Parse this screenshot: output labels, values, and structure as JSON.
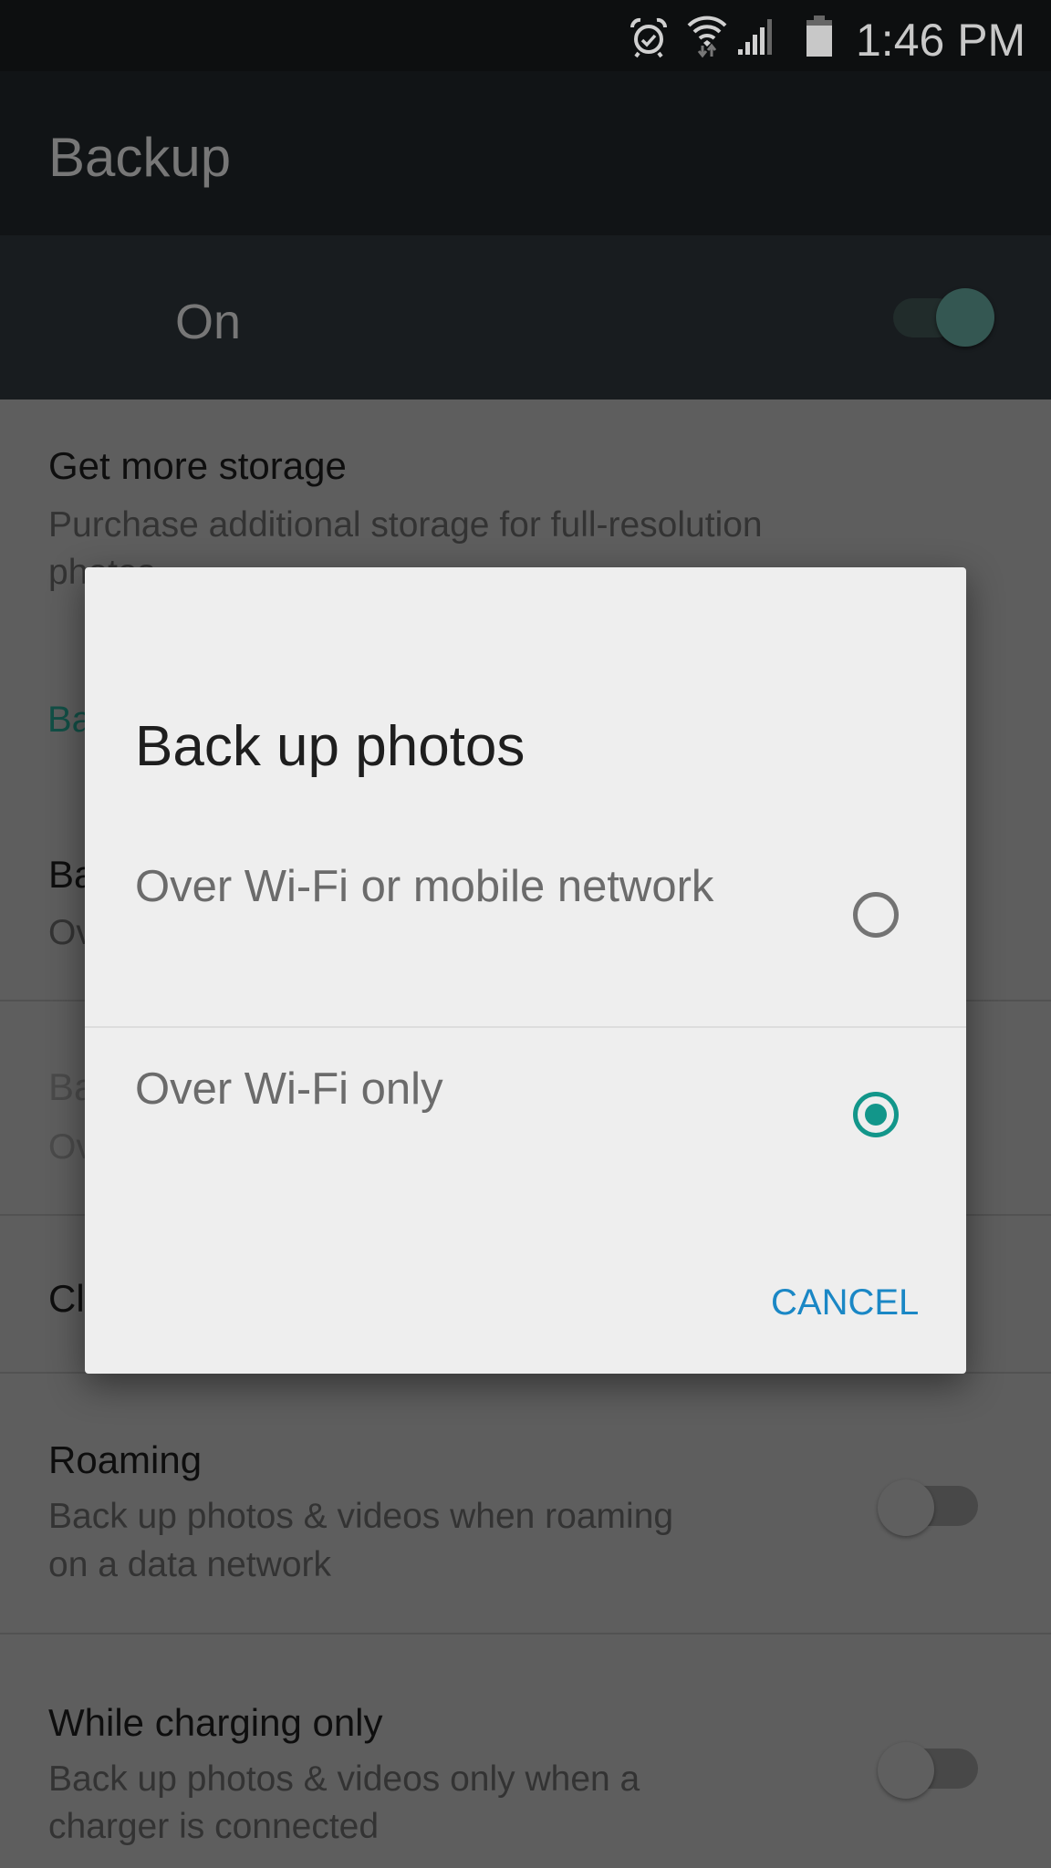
{
  "status_bar": {
    "time": "1:46 PM",
    "icons": [
      "alarm-icon",
      "wifi-icon",
      "signal-icon",
      "battery-icon"
    ]
  },
  "app_bar": {
    "title": "Backup"
  },
  "master_switch": {
    "label": "On",
    "state": "on",
    "accent_color": "#345752"
  },
  "settings": {
    "get_more_storage": {
      "title": "Get more storage",
      "subtitle_line1": "Purchase additional storage for full-resolution",
      "subtitle_line2": "photos"
    },
    "section_header_fragment": "Ba",
    "hidden_row_1": {
      "title_fragment": "Ba",
      "subtitle_fragment": "Ov"
    },
    "hidden_row_2": {
      "title_fragment": "Ba",
      "subtitle_fragment": "Ov",
      "disabled": true
    },
    "hidden_row_3": {
      "title_fragment": "Cl"
    },
    "roaming": {
      "title": "Roaming",
      "subtitle_line1": "Back up photos & videos when roaming",
      "subtitle_line2": "on a data network",
      "toggle": "off"
    },
    "charging": {
      "title": "While charging only",
      "subtitle_line1": "Back up photos & videos only when a",
      "subtitle_line2": "charger is connected",
      "toggle": "off"
    }
  },
  "dialog": {
    "title": "Back up photos",
    "options": [
      {
        "label": "Over Wi-Fi or mobile network",
        "selected": false
      },
      {
        "label": "Over Wi-Fi only",
        "selected": true
      }
    ],
    "cancel_label": "CANCEL",
    "accent_color": "#12968a",
    "button_color": "#1a87c5"
  }
}
